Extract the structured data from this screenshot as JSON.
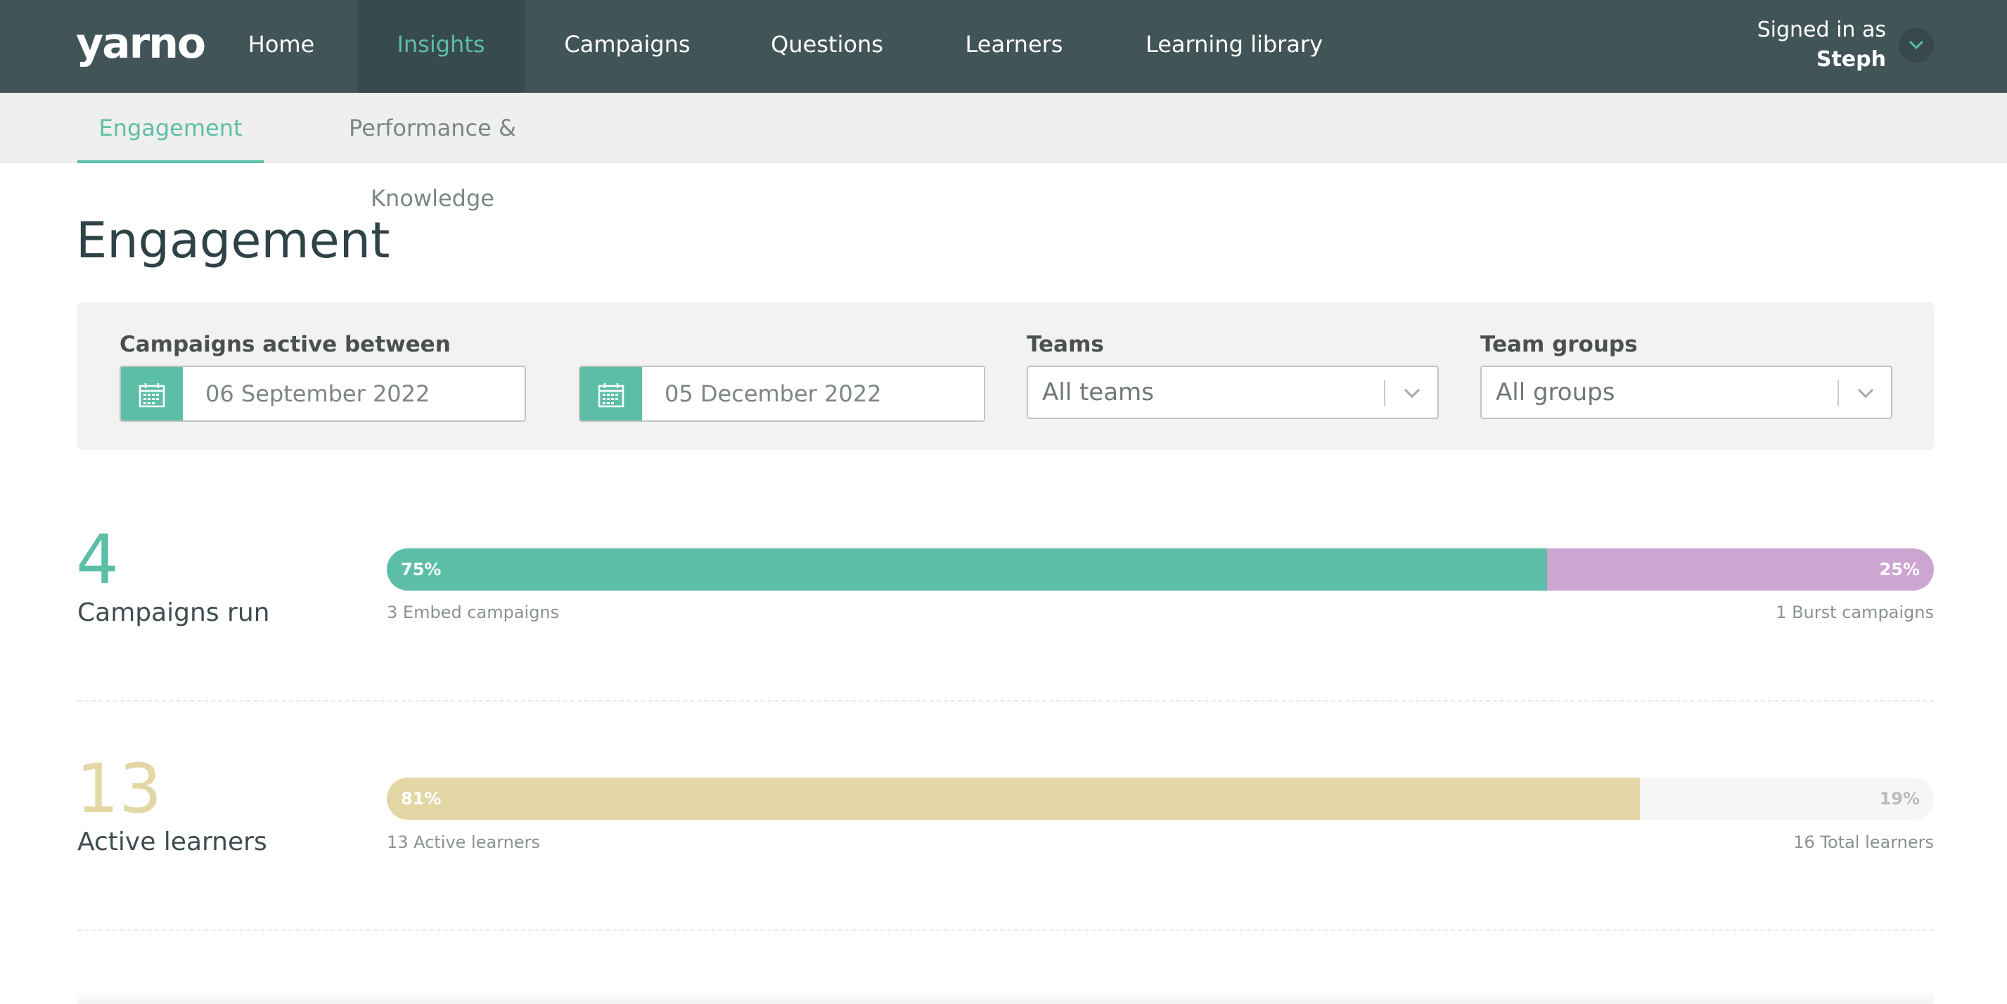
{
  "nav": {
    "logo": "yarno",
    "items": [
      {
        "label": "Home"
      },
      {
        "label": "Insights"
      },
      {
        "label": "Campaigns"
      },
      {
        "label": "Questions"
      },
      {
        "label": "Learners"
      },
      {
        "label": "Learning library"
      }
    ],
    "active": "Insights",
    "signed_in_label": "Signed in as",
    "user": "Steph"
  },
  "subnav": {
    "tabs": [
      {
        "label": "Engagement"
      },
      {
        "label": "Performance & Knowledge"
      }
    ],
    "active": "Engagement"
  },
  "page": {
    "title": "Engagement"
  },
  "filters": {
    "date_label": "Campaigns active between",
    "start_date": "06 September 2022",
    "separator": "-",
    "end_date": "05 December 2022",
    "teams_label": "Teams",
    "teams_value": "All teams",
    "groups_label": "Team groups",
    "groups_value": "All groups"
  },
  "stats": {
    "campaigns": {
      "number": "4",
      "label": "Campaigns run",
      "primary_pct": 75,
      "primary_pct_text": "75%",
      "secondary_pct_text": "25%",
      "primary_caption": "3 Embed campaigns",
      "secondary_caption": "1 Burst campaigns"
    },
    "learners": {
      "number": "13",
      "label": "Active learners",
      "primary_pct": 81,
      "primary_pct_text": "81%",
      "secondary_pct_text": "19%",
      "primary_caption": "13 Active learners",
      "secondary_caption": "16 Total learners"
    }
  },
  "colors": {
    "nav_bg": "#415457",
    "accent_teal": "#5dbea8",
    "burst_purple": "#cda5d1",
    "learner_gold": "#e3d7a6",
    "inactive_track": "#f6f6f4"
  },
  "icons": {
    "calendar": "calendar-icon",
    "chevron": "chevron-down-icon"
  }
}
